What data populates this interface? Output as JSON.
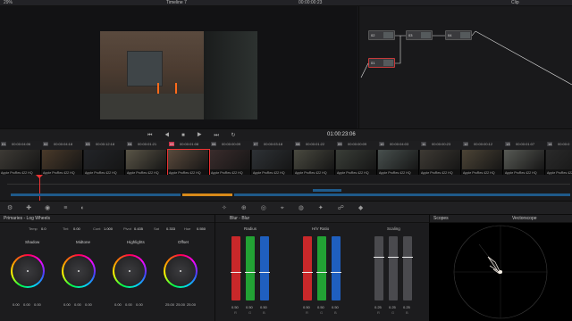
{
  "topbar": {
    "zoom": "29%",
    "timeline_name": "Timeline 7",
    "timecode": "00:00:00:23",
    "node_mode": "Clip"
  },
  "viewer": {
    "timecode": "01:00:23:06"
  },
  "nodes": [
    {
      "label": "02"
    },
    {
      "label": "01"
    },
    {
      "label": "03"
    },
    {
      "label": "04"
    }
  ],
  "clips": [
    {
      "num": "01",
      "tc": "00:00:04:06",
      "codec": "Apple ProRes 422 HQ",
      "color": "#3d3a35"
    },
    {
      "num": "02",
      "tc": "00:00:04:18",
      "codec": "Apple ProRes 422 HQ",
      "color": "#4a3a2a"
    },
    {
      "num": "03",
      "tc": "00:00:12:18",
      "codec": "Apple ProRes 422 HQ",
      "color": "#222428"
    },
    {
      "num": "04",
      "tc": "00:00:01:21",
      "codec": "Apple ProRes 422 HQ",
      "color": "#5a5547"
    },
    {
      "num": "05",
      "tc": "00:00:01:08",
      "codec": "Apple ProRes 422 HQ",
      "color": "#5b4a3c"
    },
    {
      "num": "06",
      "tc": "00:00:00:09",
      "codec": "Apple ProRes 422 HQ",
      "color": "#3a2c2c"
    },
    {
      "num": "07",
      "tc": "00:00:03:18",
      "codec": "Apple ProRes 422 HQ",
      "color": "#2e3236"
    },
    {
      "num": "08",
      "tc": "00:00:01:22",
      "codec": "Apple ProRes 422 HQ",
      "color": "#4a4a40"
    },
    {
      "num": "09",
      "tc": "00:00:00:09",
      "codec": "Apple ProRes 422 HQ",
      "color": "#3a3e38"
    },
    {
      "num": "10",
      "tc": "00:00:04:03",
      "codec": "Apple ProRes 422 HQ",
      "color": "#48504e"
    },
    {
      "num": "11",
      "tc": "00:00:00:23",
      "codec": "Apple ProRes 422 HQ",
      "color": "#3e3a34"
    },
    {
      "num": "12",
      "tc": "00:00:00:12",
      "codec": "Apple ProRes 422 HQ",
      "color": "#4c4436"
    },
    {
      "num": "13",
      "tc": "00:00:01:07",
      "codec": "Apple ProRes 422 HQ",
      "color": "#585a55"
    },
    {
      "num": "14",
      "tc": "00:00:0",
      "codec": "Apple ProRes 422 HQ",
      "color": "#2a2a2a"
    }
  ],
  "primaries": {
    "title": "Primaries - Log Wheels",
    "temp_label": "Temp",
    "temp": "0.0",
    "tint_label": "Tint",
    "tint": "0.00",
    "cont_label": "Cont",
    "cont": "1.000",
    "pivot_label": "Pivot",
    "pivot": "0.435",
    "sat_label": "Sat",
    "sat": "0.333",
    "hue_label": "Hue",
    "hue": "0.550",
    "wheels": [
      {
        "label": "Shadow",
        "vals": [
          "0.00",
          "0.00",
          "0.00"
        ]
      },
      {
        "label": "Midtone",
        "vals": [
          "0.00",
          "0.00",
          "0.00"
        ]
      },
      {
        "label": "Highlights",
        "vals": [
          "0.00",
          "0.00",
          "0.00"
        ]
      },
      {
        "label": "Offset",
        "vals": [
          "25.00",
          "25.00",
          "25.00"
        ]
      }
    ]
  },
  "blur": {
    "title": "Blur - Blur",
    "radius_label": "Radius",
    "hv_label": "H/V Ratio",
    "scaling_label": "Scaling",
    "radius": [
      "0.50",
      "0.50",
      "0.50"
    ],
    "hv": [
      "0.50",
      "0.50",
      "0.50"
    ],
    "scaling": [
      "0.25",
      "0.25",
      "0.25"
    ],
    "channels": [
      "R",
      "G",
      "B"
    ]
  },
  "scopes": {
    "title": "Scopes",
    "mode": "Vectorscope"
  }
}
